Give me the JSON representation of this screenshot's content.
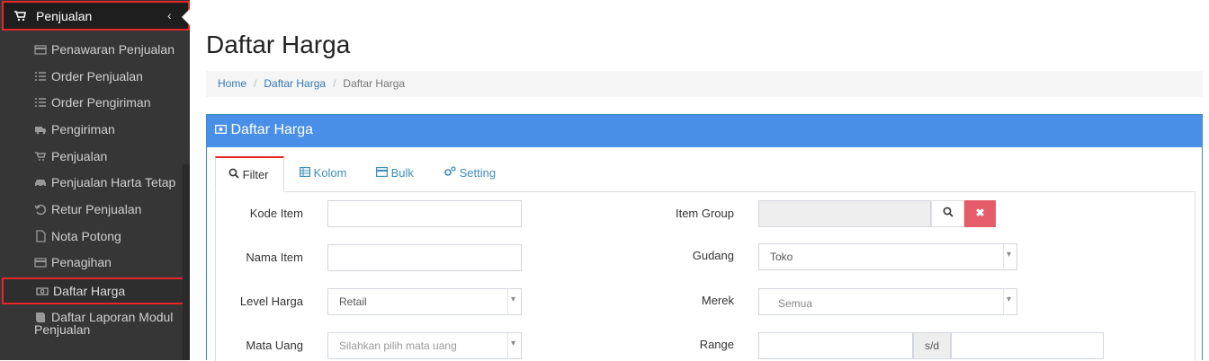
{
  "sidebar": {
    "header": "Penjualan",
    "items": [
      {
        "label": "Penawaran Penjualan"
      },
      {
        "label": "Order Penjualan"
      },
      {
        "label": "Order Pengiriman"
      },
      {
        "label": "Pengiriman"
      },
      {
        "label": "Penjualan"
      },
      {
        "label": "Penjualan Harta Tetap"
      },
      {
        "label": "Retur Penjualan"
      },
      {
        "label": "Nota Potong"
      },
      {
        "label": "Penagihan"
      },
      {
        "label": "Daftar Harga"
      },
      {
        "label": "Daftar Laporan Modul",
        "label2": "Penjualan"
      }
    ]
  },
  "page": {
    "title": "Daftar Harga"
  },
  "breadcrumb": [
    "Home",
    "Daftar Harga",
    "Daftar Harga"
  ],
  "panel": {
    "title": "Daftar Harga"
  },
  "tabs": [
    "Filter",
    "Kolom",
    "Bulk",
    "Setting"
  ],
  "form": {
    "kode_item": {
      "label": "Kode Item",
      "value": ""
    },
    "nama_item": {
      "label": "Nama Item",
      "value": ""
    },
    "level_harga": {
      "label": "Level Harga",
      "value": "Retail"
    },
    "mata_uang": {
      "label": "Mata Uang",
      "placeholder": "Silahkan pilih mata uang"
    },
    "item_group": {
      "label": "Item Group",
      "value": ""
    },
    "gudang": {
      "label": "Gudang",
      "value": "Toko"
    },
    "merek": {
      "label": "Merek",
      "value": "Semua"
    },
    "range": {
      "label": "Range",
      "separator": "s/d"
    }
  },
  "colors": {
    "accent": "#4a8fe7",
    "danger": "#e5262b",
    "sidebar": "#363636"
  }
}
